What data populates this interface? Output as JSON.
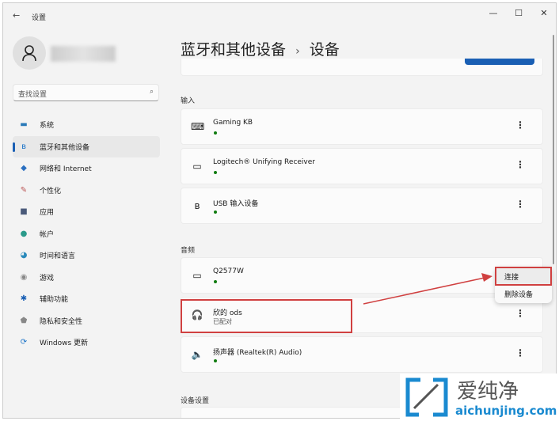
{
  "window": {
    "title": "设置",
    "back": "←",
    "minimize": "—",
    "maximize": "☐",
    "close": "✕"
  },
  "sidebar": {
    "search_placeholder": "查找设置",
    "items": [
      {
        "label": "系统",
        "icon": "▬",
        "color": "#2a7ab8"
      },
      {
        "label": "蓝牙和其他设备",
        "icon": "ʙ",
        "color": "#1a73c8"
      },
      {
        "label": "网络和 Internet",
        "icon": "◆",
        "color": "#2a6fc0"
      },
      {
        "label": "个性化",
        "icon": "✎",
        "color": "#b55"
      },
      {
        "label": "应用",
        "icon": "■",
        "color": "#4a5a7a"
      },
      {
        "label": "帐户",
        "icon": "●",
        "color": "#2a9a8a"
      },
      {
        "label": "时间和语言",
        "icon": "◕",
        "color": "#2a8abb"
      },
      {
        "label": "游戏",
        "icon": "◉",
        "color": "#888"
      },
      {
        "label": "辅助功能",
        "icon": "✱",
        "color": "#1a5fb4"
      },
      {
        "label": "隐私和安全性",
        "icon": "⬟",
        "color": "#888"
      },
      {
        "label": "Windows 更新",
        "icon": "⟳",
        "color": "#1a73c8"
      }
    ]
  },
  "header": {
    "breadcrumb_parent": "蓝牙和其他设备",
    "separator": "›",
    "title": "设备"
  },
  "sections": {
    "input": "输入",
    "audio": "音频",
    "device_settings": "设备设置"
  },
  "input_devices": [
    {
      "name": "Gaming KB",
      "icon": "⌨"
    },
    {
      "name": "Logitech® Unifying Receiver",
      "icon": "▭"
    },
    {
      "name": "USB 输入设备",
      "icon": "ʙ"
    }
  ],
  "audio_devices": [
    {
      "name": "Q2577W",
      "icon": "▭"
    },
    {
      "name": "欣的  ods",
      "status": "已配对",
      "icon": "🎧"
    },
    {
      "name": "扬声器 (Realtek(R) Audio)",
      "icon": "🔈"
    }
  ],
  "context_menu": {
    "connect": "连接",
    "remove": "删除设备"
  },
  "more": "⋮",
  "watermark": {
    "cn": "爱纯净",
    "url": "aichunjing.com"
  }
}
